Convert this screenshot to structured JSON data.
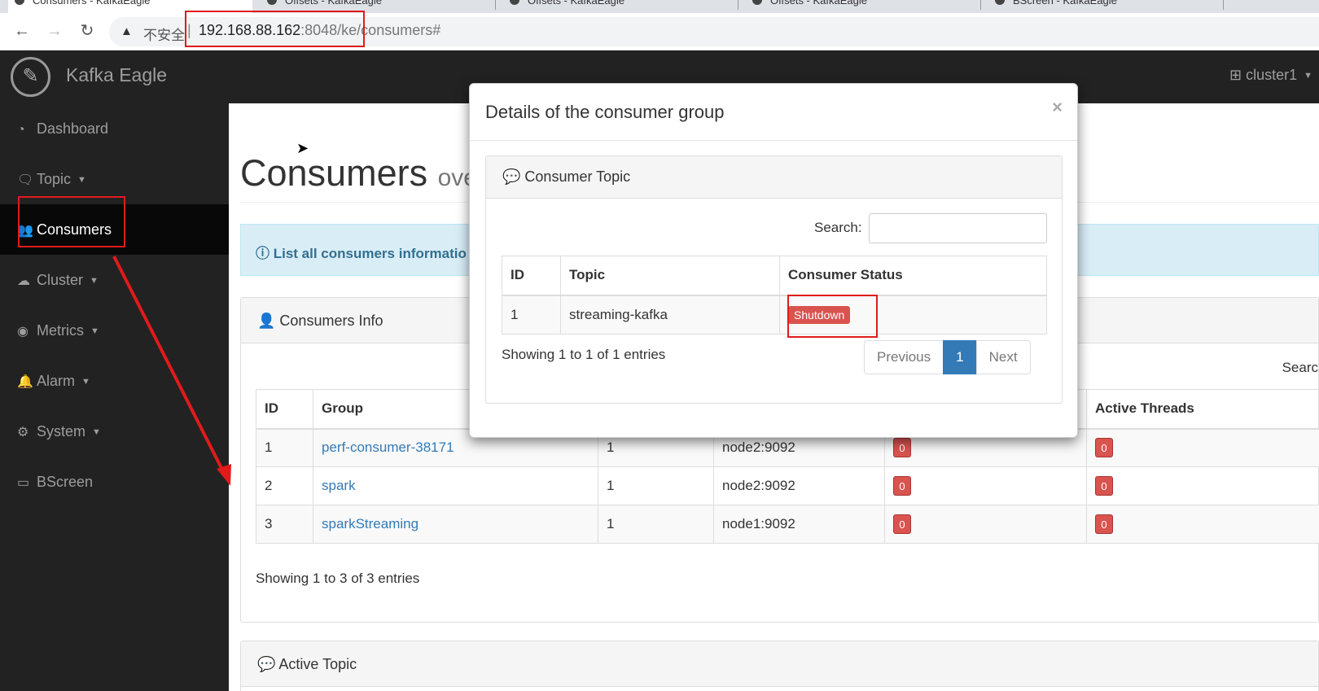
{
  "browser": {
    "tabs": [
      {
        "label": "Consumers - KafkaEagle"
      },
      {
        "label": "Offsets - KafkaEagle"
      },
      {
        "label": "Offsets - KafkaEagle"
      },
      {
        "label": "Offsets - KafkaEagle"
      },
      {
        "label": "BScreen - KafkaEagle"
      }
    ],
    "insecure_label": "不安全",
    "url_host": "192.168.88.162",
    "url_port": ":8048",
    "url_path": "/ke/consumers#"
  },
  "app": {
    "brand": "Kafka Eagle",
    "cluster": "cluster1"
  },
  "sidebar": {
    "items": [
      {
        "label": "Dashboard",
        "icon": "dashboard-icon"
      },
      {
        "label": "Topic",
        "icon": "comments-icon"
      },
      {
        "label": "Consumers",
        "icon": "users-icon"
      },
      {
        "label": "Cluster",
        "icon": "cloud-icon"
      },
      {
        "label": "Metrics",
        "icon": "eye-icon"
      },
      {
        "label": "Alarm",
        "icon": "bell-icon"
      },
      {
        "label": "System",
        "icon": "gear-icon"
      },
      {
        "label": "BScreen",
        "icon": "desktop-icon"
      }
    ]
  },
  "page": {
    "title": "Consumers",
    "subtitle": "ove",
    "alert": "List all consumers informatio",
    "consumers_panel_title": "Consumers Info",
    "search_label": "Searc",
    "table": {
      "headers": [
        "ID",
        "Group",
        "",
        "",
        "",
        "Active Threads"
      ],
      "rows": [
        {
          "id": "1",
          "group": "perf-consumer-38171",
          "topics": "1",
          "node": "node2:9092",
          "active_topics": "0",
          "active_threads": "0"
        },
        {
          "id": "2",
          "group": "spark",
          "topics": "1",
          "node": "node2:9092",
          "active_topics": "0",
          "active_threads": "0"
        },
        {
          "id": "3",
          "group": "sparkStreaming",
          "topics": "1",
          "node": "node1:9092",
          "active_topics": "0",
          "active_threads": "0"
        }
      ]
    },
    "showing": "Showing 1 to 3 of 3 entries",
    "active_topic_title": "Active Topic"
  },
  "modal": {
    "title": "Details of the consumer group",
    "close": "×",
    "panel_title": "Consumer Topic",
    "search_label": "Search:",
    "table": {
      "headers": [
        "ID",
        "Topic",
        "Consumer Status"
      ],
      "rows": [
        {
          "id": "1",
          "topic": "streaming-kafka",
          "status": "Shutdown"
        }
      ]
    },
    "showing": "Showing 1 to 1 of 1 entries",
    "pager": {
      "previous": "Previous",
      "current": "1",
      "next": "Next"
    }
  },
  "colors": {
    "annotation": "#e01b1b",
    "danger": "#d9534f",
    "primary": "#337ab7",
    "sidebar": "#222222"
  }
}
